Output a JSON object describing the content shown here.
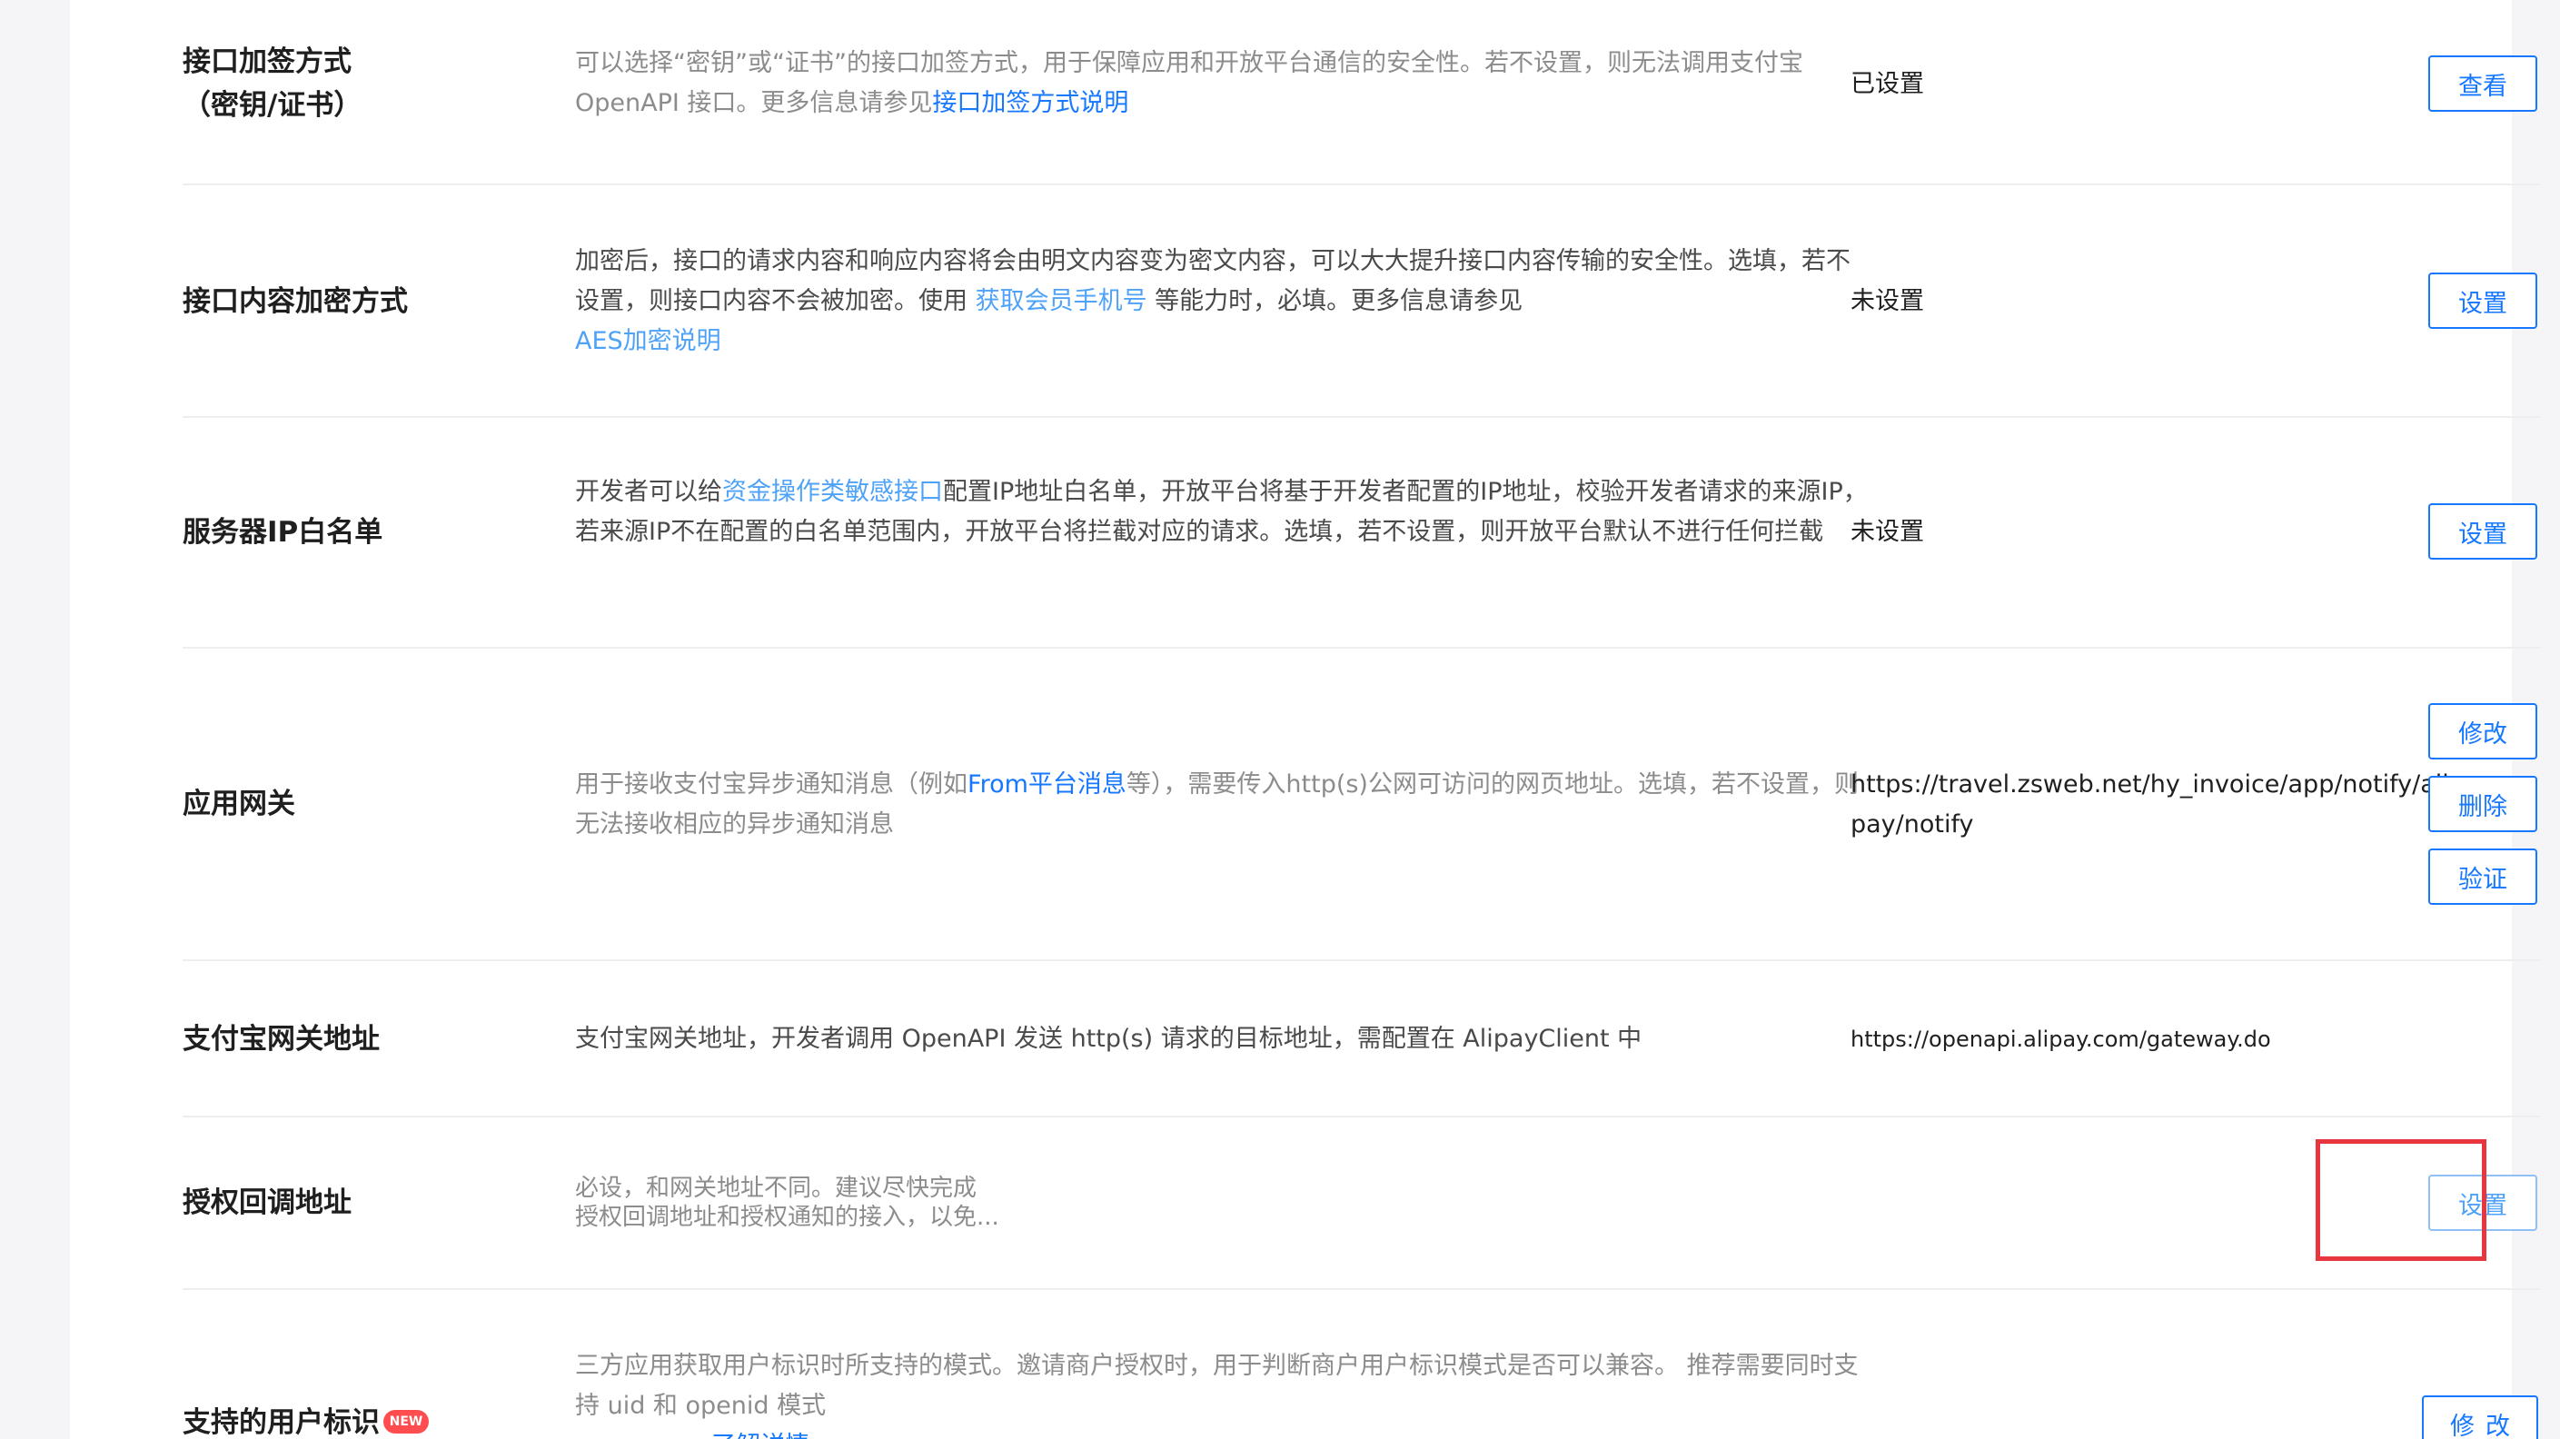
{
  "rows": [
    {
      "label_line1": "接口加签方式",
      "label_line2": "（密钥/证书）",
      "desc_text": "可以选择“密钥”或“证书”的接口加签方式，用于保障应用和开放平台通信的安全性。若不设置，则无法调用支付宝 OpenAPI 接口。更多信息请参见",
      "desc_link": "接口加签方式说明",
      "value": "已设置",
      "button": "查看"
    },
    {
      "label": "接口内容加密方式",
      "desc_part1": "加密后，接口的请求内容和响应内容将会由明文内容变为密文内容，可以大大提升接口内容传输的安全性。选填，若不设置，则接口内容不会被加密。使用 ",
      "desc_link1": "获取会员手机号",
      "desc_part2": " 等能力时，必填。更多信息请参见",
      "desc_link2": "AES加密说明",
      "value": "未设置",
      "button": "设置"
    },
    {
      "label": "服务器IP白名单",
      "desc_part1": "开发者可以给",
      "desc_link": "资金操作类敏感接口",
      "desc_part2": "配置IP地址白名单，开放平台将基于开发者配置的IP地址，校验开发者请求的来源IP，若来源IP不在配置的白名单范围内，开放平台将拦截对应的请求。选填，若不设置，则开放平台默认不进行任何拦截",
      "value": "未设置",
      "button": "设置"
    },
    {
      "label": "应用网关",
      "desc_part1": "用于接收支付宝异步通知消息（例如",
      "desc_link": "From平台消息",
      "desc_part2": "等），需要传入http(s)公网可访问的网页地址。选填，若不设置，则无法接收相应的异步通知消息",
      "value": "https://travel.zsweb.net/hy_invoice/app/notify/alipay/notify",
      "buttons": [
        "修改",
        "删除",
        "验证"
      ]
    },
    {
      "label": "支付宝网关地址",
      "desc": "支付宝网关地址，开发者调用 OpenAPI 发送 http(s) 请求的目标地址，需配置在 AlipayClient 中",
      "value": "https://openapi.alipay.com/gateway.do"
    },
    {
      "label": "授权回调地址",
      "desc_line1": "必设，和网关地址不同。建议尽快完成",
      "desc_line2": "授权回调地址和授权通知的接入，以免...",
      "button": "设置"
    },
    {
      "label": "支持的用户标识",
      "badge": "NEW",
      "desc_line1": "三方应用获取用户标识时所支持的模式。邀请商户授权时，用于判断商户用户标识模式是否可以兼容。 推荐需要同时支持 uid 和 openid 模式",
      "desc_link": "了解详情",
      "button": "修改"
    }
  ],
  "colors": {
    "link": "#1677ff",
    "highlight_border": "#e8363f",
    "badge": "#ff4d4f"
  }
}
